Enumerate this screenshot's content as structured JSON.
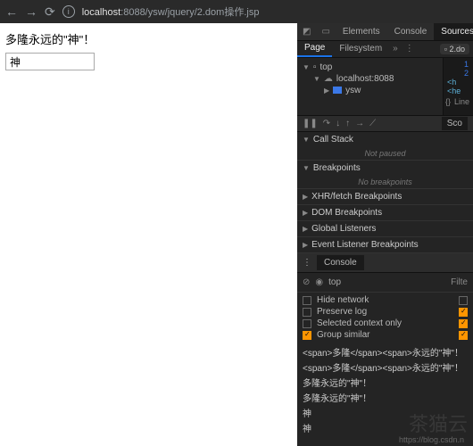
{
  "toolbar": {
    "url_host": "localhost",
    "url_rest": ":8088/ysw/jquery/2.dom操作.jsp"
  },
  "page": {
    "heading": "多隆永远的\"神\"！",
    "input_value": "神"
  },
  "devtools": {
    "tabs": [
      "Elements",
      "Console",
      "Sources"
    ],
    "active_tab": "Sources",
    "sub_tabs": {
      "page": "Page",
      "filesystem": "Filesystem",
      "file_chip": "2.do"
    },
    "tree": {
      "top": "top",
      "host": "localhost:8088",
      "folder": "ysw"
    },
    "gutter": {
      "l1": "1",
      "l2": "2",
      "frag1": "<h",
      "frag2": "<he",
      "line_label": "Line"
    },
    "debugger": {
      "scope": "Sco"
    },
    "accordion": {
      "call_stack": "Call Stack",
      "not_paused": "Not paused",
      "breakpoints": "Breakpoints",
      "no_bp": "No breakpoints",
      "xhr": "XHR/fetch Breakpoints",
      "dom": "DOM Breakpoints",
      "global": "Global Listeners",
      "event": "Event Listener Breakpoints"
    },
    "console": {
      "tab": "Console",
      "top": "top",
      "filter": "Filte",
      "opts": {
        "hide": "Hide network",
        "preserve": "Preserve log",
        "selected": "Selected context only",
        "group": "Group similar"
      },
      "logs": [
        "<span>多隆</span><span>永远的\"神\"！",
        "<span>多隆</span><span>永远的\"神\"！",
        "多隆永远的\"神\"！",
        "多隆永远的\"神\"！",
        "神",
        "神"
      ],
      "src_url": "https://blog.csdn.n"
    }
  },
  "watermark": "茶猫云"
}
